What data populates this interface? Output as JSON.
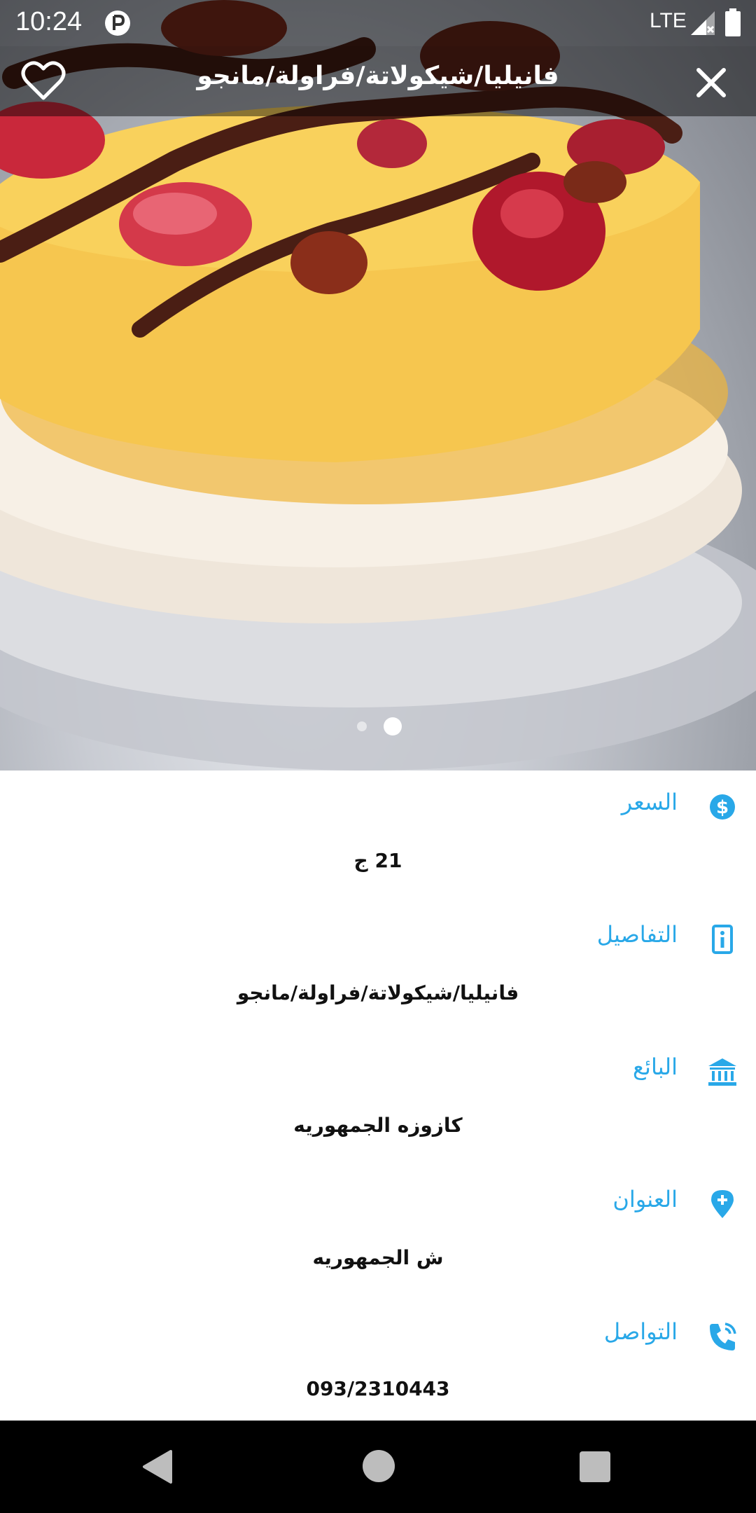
{
  "status_bar": {
    "time": "10:24",
    "network": "LTE",
    "app_icon": "p-circle-icon",
    "signal_icon": "signal-icon",
    "battery_icon": "battery-icon"
  },
  "header": {
    "title": "فانيليا/شيكولاتة/فراولة/مانجو",
    "favorite_icon": "heart-outline-icon",
    "close_icon": "close-icon"
  },
  "gallery": {
    "page_count": 2,
    "current_page": 2
  },
  "details": {
    "price": {
      "label": "السعر",
      "value": "21 ج",
      "icon": "dollar-circle-icon"
    },
    "info": {
      "label": "التفاصيل",
      "value": "فانيليا/شيكولاتة/فراولة/مانجو",
      "icon": "info-icon"
    },
    "seller": {
      "label": "البائع",
      "value": "كازوزه الجمهوريه",
      "icon": "bank-icon"
    },
    "address": {
      "label": "العنوان",
      "value": "ش الجمهوريه",
      "icon": "location-pin-icon"
    },
    "contact": {
      "label": "التواصل",
      "value": "093/2310443",
      "icon": "phone-icon"
    }
  },
  "colors": {
    "accent": "#29a8e8",
    "text": "#111111"
  }
}
